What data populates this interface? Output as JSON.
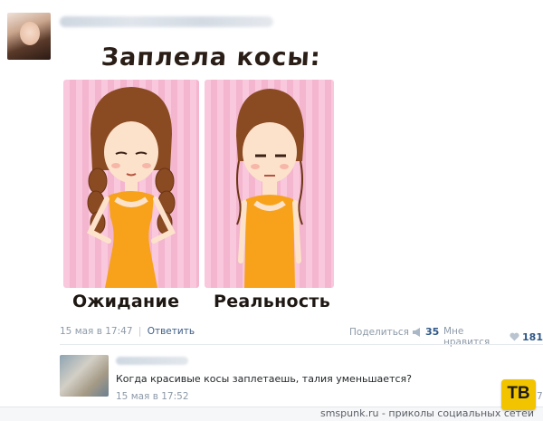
{
  "post": {
    "comic_title": "Заплела косы:",
    "captions": {
      "expectation": "Ожидание",
      "reality": "Реальность"
    },
    "date": "15 мая в 17:47",
    "separator": "|",
    "reply": "Ответить",
    "share_label": "Поделиться",
    "share_count": "35",
    "like_label": "Мне нравится",
    "like_count": "181"
  },
  "comment": {
    "text": "Когда красивые косы заплетаешь, талия уменьшается?",
    "date": "15 мая в 17:52",
    "extra": "7"
  },
  "footer": {
    "text": "smspunk.ru - приколы социальных сетей"
  },
  "badge": {
    "text": "ТВ"
  },
  "colors": {
    "link": "#2f5786",
    "muted": "#8e9aa8",
    "badge": "#f2c400",
    "panel_pink": "#f9c8dd"
  },
  "icons": {
    "share": "megaphone-icon",
    "like": "heart-icon"
  }
}
